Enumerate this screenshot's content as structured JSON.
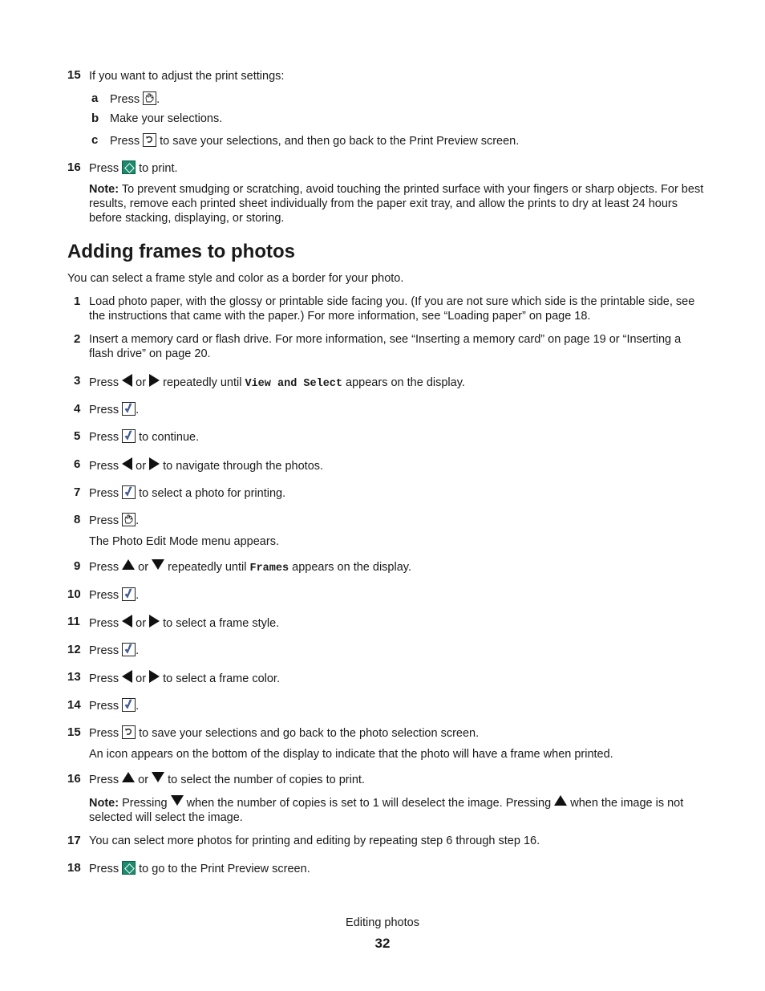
{
  "top_steps": {
    "s15": {
      "num": "15",
      "text": "If you want to adjust the print settings:"
    },
    "s15a": {
      "letter": "a",
      "pre": "Press",
      "post": "."
    },
    "s15b": {
      "letter": "b",
      "text": "Make your selections."
    },
    "s15c": {
      "letter": "c",
      "pre": "Press",
      "post": "to save your selections, and then go back to the Print Preview screen."
    },
    "s16": {
      "num": "16",
      "pre": "Press",
      "post": "to print."
    },
    "note": {
      "label": "Note:",
      "text": "To prevent smudging or scratching, avoid touching the printed surface with your fingers or sharp objects. For best results, remove each printed sheet individually from the paper exit tray, and allow the prints to dry at least 24 hours before stacking, displaying, or storing."
    }
  },
  "section": {
    "title": "Adding frames to photos",
    "intro": "You can select a frame style and color as a border for your photo."
  },
  "steps": {
    "s1": {
      "num": "1",
      "text": "Load photo paper, with the glossy or printable side facing you. (If you are not sure which side is the printable side, see the instructions that came with the paper.) For more information, see “Loading paper” on page 18."
    },
    "s2": {
      "num": "2",
      "text": "Insert a memory card or flash drive. For more information, see “Inserting a memory card” on page 19 or “Inserting a flash drive” on page 20."
    },
    "s3": {
      "num": "3",
      "pre": "Press",
      "or": "or",
      "mid": "repeatedly until",
      "code": "View and Select",
      "post": "appears on the display."
    },
    "s4": {
      "num": "4",
      "pre": "Press",
      "post": "."
    },
    "s5": {
      "num": "5",
      "pre": "Press",
      "post": "to continue."
    },
    "s6": {
      "num": "6",
      "pre": "Press",
      "or": "or",
      "post": "to navigate through the photos."
    },
    "s7": {
      "num": "7",
      "pre": "Press",
      "post": "to select a photo for printing."
    },
    "s8": {
      "num": "8",
      "pre": "Press",
      "post": ".",
      "sub": "The Photo Edit Mode menu appears."
    },
    "s9": {
      "num": "9",
      "pre": "Press",
      "or": "or",
      "mid": "repeatedly until",
      "code": "Frames",
      "post": "appears on the display."
    },
    "s10": {
      "num": "10",
      "pre": "Press",
      "post": "."
    },
    "s11": {
      "num": "11",
      "pre": "Press",
      "or": "or",
      "post": "to select a frame style."
    },
    "s12": {
      "num": "12",
      "pre": "Press",
      "post": "."
    },
    "s13": {
      "num": "13",
      "pre": "Press",
      "or": "or",
      "post": "to select a frame color."
    },
    "s14": {
      "num": "14",
      "pre": "Press",
      "post": "."
    },
    "s15": {
      "num": "15",
      "pre": "Press",
      "post": "to save your selections and go back to the photo selection screen.",
      "sub": "An icon appears on the bottom of the display to indicate that the photo will have a frame when printed."
    },
    "s16": {
      "num": "16",
      "pre": "Press",
      "or": "or",
      "post": "to select the number of copies to print."
    },
    "note2": {
      "label": "Note:",
      "a": "Pressing",
      "b": "when the number of copies is set to 1 will deselect the image. Pressing",
      "c": "when the image is not selected will select the image."
    },
    "s17": {
      "num": "17",
      "text": "You can select more photos for printing and editing by repeating step 6 through step 16."
    },
    "s18": {
      "num": "18",
      "pre": "Press",
      "post": "to go to the Print Preview screen."
    }
  },
  "footer": {
    "chapter": "Editing photos",
    "page": "32"
  },
  "colors": {
    "start_button": "#1b8a6d",
    "check_mark": "#4a6fb5"
  }
}
